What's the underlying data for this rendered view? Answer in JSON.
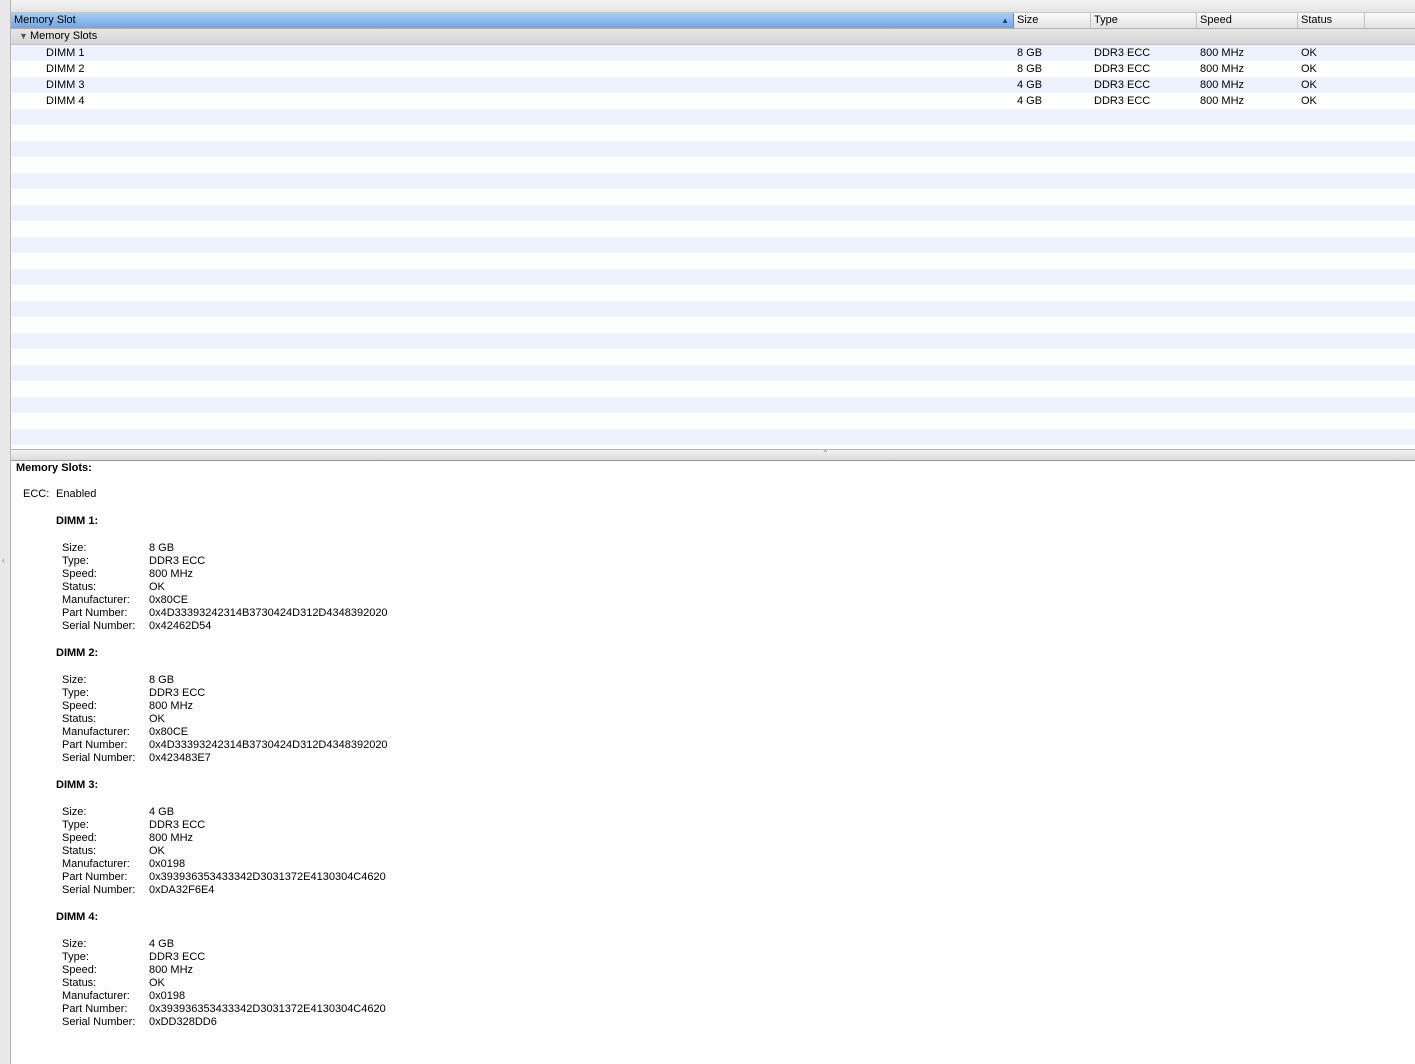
{
  "table": {
    "columns": [
      {
        "label": "Memory Slot",
        "sorted": true
      },
      {
        "label": "Size"
      },
      {
        "label": "Type"
      },
      {
        "label": "Speed"
      },
      {
        "label": "Status"
      }
    ],
    "group_label": "Memory Slots",
    "rows": [
      {
        "slot": "DIMM 1",
        "size": "8 GB",
        "type": "DDR3 ECC",
        "speed": "800 MHz",
        "status": "OK"
      },
      {
        "slot": "DIMM 2",
        "size": "8 GB",
        "type": "DDR3 ECC",
        "speed": "800 MHz",
        "status": "OK"
      },
      {
        "slot": "DIMM 3",
        "size": "4 GB",
        "type": "DDR3 ECC",
        "speed": "800 MHz",
        "status": "OK"
      },
      {
        "slot": "DIMM 4",
        "size": "4 GB",
        "type": "DDR3 ECC",
        "speed": "800 MHz",
        "status": "OK"
      }
    ]
  },
  "detail": {
    "title": "Memory Slots:",
    "ecc_label": "ECC:",
    "ecc_value": "Enabled",
    "dimms": [
      {
        "title": "DIMM 1:",
        "props": [
          {
            "key": "Size:",
            "value": "8 GB"
          },
          {
            "key": "Type:",
            "value": "DDR3 ECC"
          },
          {
            "key": "Speed:",
            "value": "800 MHz"
          },
          {
            "key": "Status:",
            "value": "OK"
          },
          {
            "key": "Manufacturer:",
            "value": "0x80CE"
          },
          {
            "key": "Part Number:",
            "value": "0x4D33393242314B3730424D312D4348392020"
          },
          {
            "key": "Serial Number:",
            "value": "0x42462D54"
          }
        ]
      },
      {
        "title": "DIMM 2:",
        "props": [
          {
            "key": "Size:",
            "value": "8 GB"
          },
          {
            "key": "Type:",
            "value": "DDR3 ECC"
          },
          {
            "key": "Speed:",
            "value": "800 MHz"
          },
          {
            "key": "Status:",
            "value": "OK"
          },
          {
            "key": "Manufacturer:",
            "value": "0x80CE"
          },
          {
            "key": "Part Number:",
            "value": "0x4D33393242314B3730424D312D4348392020"
          },
          {
            "key": "Serial Number:",
            "value": "0x423483E7"
          }
        ]
      },
      {
        "title": "DIMM 3:",
        "props": [
          {
            "key": "Size:",
            "value": "4 GB"
          },
          {
            "key": "Type:",
            "value": "DDR3 ECC"
          },
          {
            "key": "Speed:",
            "value": "800 MHz"
          },
          {
            "key": "Status:",
            "value": "OK"
          },
          {
            "key": "Manufacturer:",
            "value": "0x0198"
          },
          {
            "key": "Part Number:",
            "value": "0x393936353433342D3031372E4130304C4620"
          },
          {
            "key": "Serial Number:",
            "value": "0xDA32F6E4"
          }
        ]
      },
      {
        "title": "DIMM 4:",
        "props": [
          {
            "key": "Size:",
            "value": "4 GB"
          },
          {
            "key": "Type:",
            "value": "DDR3 ECC"
          },
          {
            "key": "Speed:",
            "value": "800 MHz"
          },
          {
            "key": "Status:",
            "value": "OK"
          },
          {
            "key": "Manufacturer:",
            "value": "0x0198"
          },
          {
            "key": "Part Number:",
            "value": "0x393936353433342D3031372E4130304C4620"
          },
          {
            "key": "Serial Number:",
            "value": "0xDD328DD6"
          }
        ]
      }
    ]
  },
  "icons": {
    "sort_ascending": "sort-ascending-icon",
    "disclosure_open": "disclosure-triangle-icon",
    "splitter_grip": "splitter-grip-icon"
  },
  "colors": {
    "sorted_header": "#6fa6e6",
    "alt_row": "#edf3fe"
  }
}
